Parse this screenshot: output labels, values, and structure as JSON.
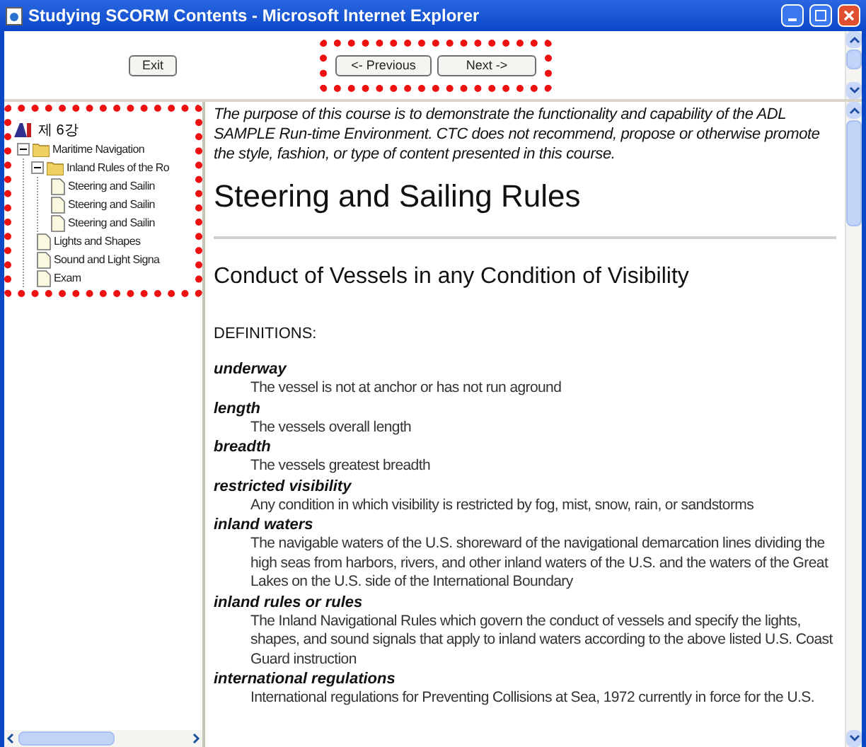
{
  "window": {
    "title": "Studying SCORM Contents - Microsoft Internet Explorer"
  },
  "toolbar": {
    "exit": "Exit",
    "previous": "<- Previous",
    "next": "Next ->"
  },
  "tree": {
    "label": "제 6강",
    "children": [
      {
        "label": "Maritime Navigation",
        "kind": "folder",
        "expanded": true,
        "children": [
          {
            "label": "Inland Rules of the Ro",
            "kind": "folder",
            "expanded": true,
            "children": [
              {
                "label": "Steering and Sailin",
                "kind": "page"
              },
              {
                "label": "Steering and Sailin",
                "kind": "page"
              },
              {
                "label": "Steering and Sailin",
                "kind": "page"
              }
            ]
          },
          {
            "label": "Lights and Shapes",
            "kind": "page"
          },
          {
            "label": "Sound and Light Signa",
            "kind": "page"
          },
          {
            "label": "Exam",
            "kind": "page"
          }
        ]
      }
    ]
  },
  "content": {
    "disclaimer": "The purpose of this course is to demonstrate the functionality and capability of the ADL SAMPLE Run-time Environment. CTC does not recommend, propose or otherwise promote the style, fashion, or type of content presented in this course.",
    "title": "Steering and Sailing Rules",
    "subtitle": "Conduct of Vessels in any Condition of Visibility",
    "definitions_heading": "DEFINITIONS:",
    "definitions": [
      {
        "term": "underway",
        "text": "The vessel is not at anchor or has not run aground"
      },
      {
        "term": "length",
        "text": "The vessels overall length"
      },
      {
        "term": "breadth",
        "text": "The vessels greatest breadth"
      },
      {
        "term": "restricted visibility",
        "text": "Any condition in which visibility is restricted by fog, mist, snow, rain, or sandstorms"
      },
      {
        "term": "inland waters",
        "text": "The navigable waters of the U.S. shoreward of the navigational demarcation lines dividing the high seas from harbors, rivers, and other inland waters of the U.S. and the waters of the Great Lakes on the U.S. side of the International Boundary"
      },
      {
        "term": "inland rules or rules",
        "text": "The Inland Navigational Rules which govern the conduct of vessels and specify the lights, shapes, and sound signals that apply to inland waters according to the above listed U.S. Coast Guard instruction"
      },
      {
        "term": "international regulations",
        "text": "International regulations for Preventing Collisions at Sea, 1972 currently in force for the U.S."
      }
    ]
  }
}
